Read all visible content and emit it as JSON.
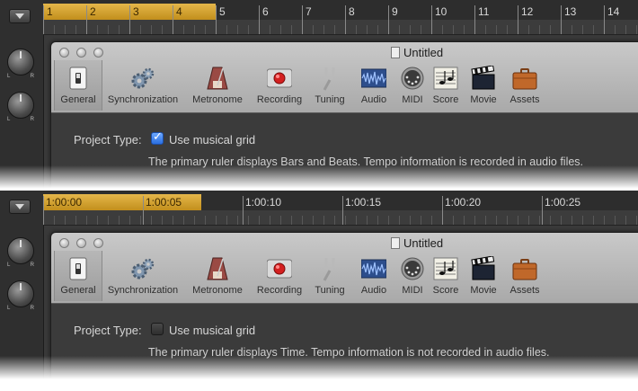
{
  "colors": {
    "cycle_accent": "#d9a534",
    "checkbox_blue": "#3b7ff0"
  },
  "top": {
    "ruler_labels": [
      "1",
      "2",
      "3",
      "4",
      "5",
      "6",
      "7",
      "8",
      "9",
      "10",
      "11",
      "12",
      "13",
      "14"
    ],
    "window": {
      "title": "Untitled",
      "toolbar": [
        {
          "label": "General",
          "icon": "general-switch-icon"
        },
        {
          "label": "Synchronization",
          "icon": "gears-icon"
        },
        {
          "label": "Metronome",
          "icon": "metronome-icon"
        },
        {
          "label": "Recording",
          "icon": "record-icon"
        },
        {
          "label": "Tuning",
          "icon": "tuning-fork-icon"
        },
        {
          "label": "Audio",
          "icon": "audio-waveform-icon"
        },
        {
          "label": "MIDI",
          "icon": "midi-connector-icon"
        },
        {
          "label": "Score",
          "icon": "score-notes-icon"
        },
        {
          "label": "Movie",
          "icon": "clapperboard-icon"
        },
        {
          "label": "Assets",
          "icon": "briefcase-icon"
        }
      ],
      "project_type_label": "Project Type:",
      "checkbox_label": "Use musical grid",
      "checkbox_checked": true,
      "description": "The primary ruler displays Bars and Beats. Tempo information is recorded in audio files."
    }
  },
  "bottom": {
    "ruler_labels": [
      "1:00:00",
      "1:00:05",
      "1:00:10",
      "1:00:15",
      "1:00:20",
      "1:00:25"
    ],
    "window": {
      "title": "Untitled",
      "toolbar": [
        {
          "label": "General",
          "icon": "general-switch-icon"
        },
        {
          "label": "Synchronization",
          "icon": "gears-icon"
        },
        {
          "label": "Metronome",
          "icon": "metronome-icon"
        },
        {
          "label": "Recording",
          "icon": "record-icon"
        },
        {
          "label": "Tuning",
          "icon": "tuning-fork-icon"
        },
        {
          "label": "Audio",
          "icon": "audio-waveform-icon"
        },
        {
          "label": "MIDI",
          "icon": "midi-connector-icon"
        },
        {
          "label": "Score",
          "icon": "score-notes-icon"
        },
        {
          "label": "Movie",
          "icon": "clapperboard-icon"
        },
        {
          "label": "Assets",
          "icon": "briefcase-icon"
        }
      ],
      "project_type_label": "Project Type:",
      "checkbox_label": "Use musical grid",
      "checkbox_checked": false,
      "description": "The primary ruler displays Time. Tempo information is not recorded in audio files."
    }
  }
}
